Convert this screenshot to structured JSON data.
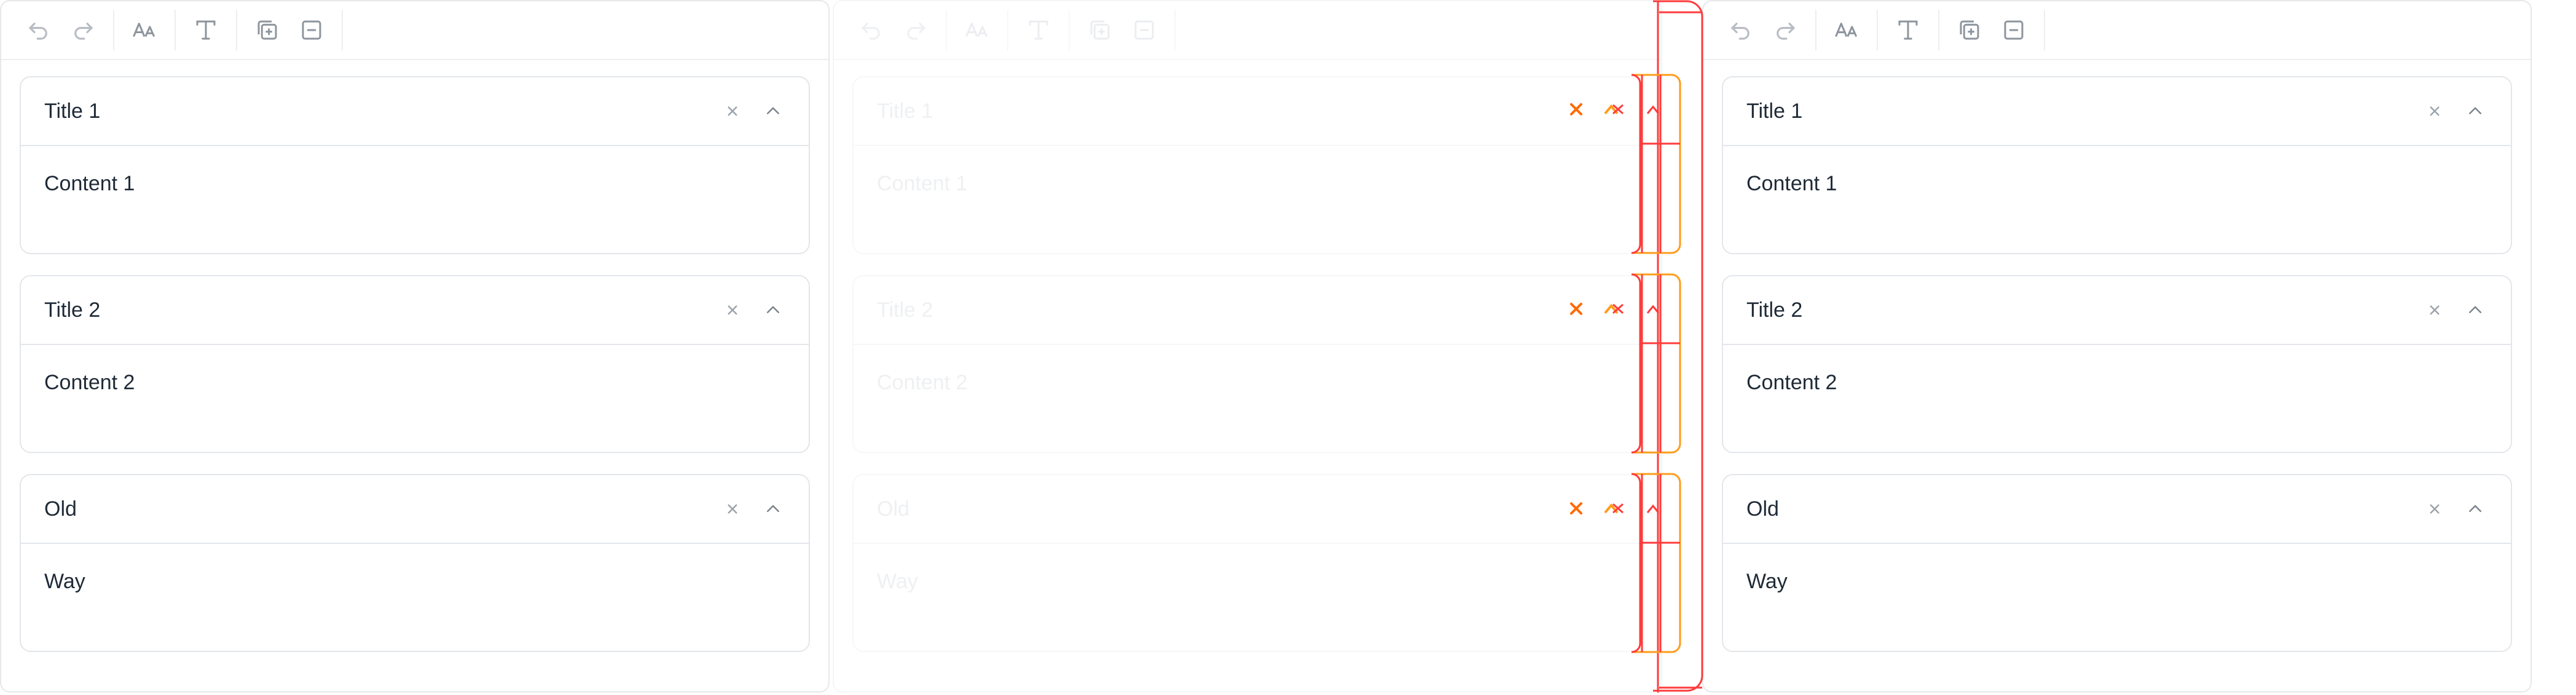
{
  "toolbar": {
    "undo_icon": "undo-icon",
    "redo_icon": "redo-icon",
    "font_size_icon": "font-size-icon",
    "text_format_icon": "text-format-icon",
    "duplicate_icon": "duplicate-plus-icon",
    "remove_icon": "remove-minus-icon"
  },
  "panels": [
    {
      "name": "left",
      "items": [
        {
          "title": "Title 1",
          "content": "Content 1"
        },
        {
          "title": "Title 2",
          "content": "Content 2"
        },
        {
          "title": "Old",
          "content": "Way"
        }
      ]
    },
    {
      "name": "center",
      "items": [
        {
          "title": "Title 1",
          "content": "Content 1"
        },
        {
          "title": "Title 2",
          "content": "Content 2"
        },
        {
          "title": "Old",
          "content": "Way"
        }
      ]
    },
    {
      "name": "right",
      "items": [
        {
          "title": "Title 1",
          "content": "Content 1"
        },
        {
          "title": "Title 2",
          "content": "Content 2"
        },
        {
          "title": "Old",
          "content": "Way"
        }
      ]
    }
  ],
  "colors": {
    "text": "#1f2a37",
    "icon": "#a0a7b0",
    "border": "#e3e6ea",
    "debug_red": "#ff3b3b",
    "debug_orange": "#ff9c1a",
    "debug_x": "#ff6a00"
  }
}
